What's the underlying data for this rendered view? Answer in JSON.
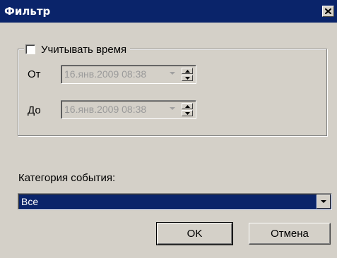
{
  "window": {
    "title": "Фильтр",
    "close_icon": "close-icon"
  },
  "filter_time": {
    "checkbox_label": "Учитывать время",
    "checked": false,
    "from_label": "От",
    "from_value": "16.янв.2009 08:38",
    "to_label": "До",
    "to_value": "16.янв.2009 08:38"
  },
  "category": {
    "label": "Категория события:",
    "selected": "Все"
  },
  "buttons": {
    "ok": "OK",
    "cancel": "Отмена"
  }
}
